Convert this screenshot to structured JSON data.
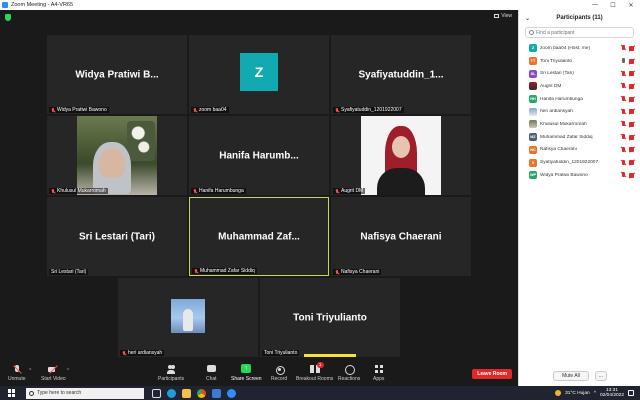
{
  "window": {
    "title": "Zoom Meeting - A4-VR65",
    "minimize": "—",
    "maximize": "☐",
    "close": "✕"
  },
  "meeting": {
    "view_label": "View",
    "tiles": [
      {
        "big": "Widya Pratiwi B...",
        "label": "Widya Pratiwi Bawono"
      },
      {
        "big": "",
        "avatar": "Z",
        "label": "zoom baa04"
      },
      {
        "big": "Syafiyatuddin_1...",
        "label": "Syafiyatuddin_1201922007"
      },
      {
        "big": "",
        "label": "Khulusul Mukarromah"
      },
      {
        "big": "Hanifa  Harumb...",
        "label": "Hanifa Harumbunga"
      },
      {
        "big": "",
        "label": "Augrit DM"
      },
      {
        "big": "Sri Lestari (Tari)",
        "label": "Sri Lestari (Tari)"
      },
      {
        "big": "Muhammad  Zaf...",
        "label": "Muhammad Zafar Siddiq"
      },
      {
        "big": "Nafisya Chaerani",
        "label": "Nafisya Chaerani"
      },
      {
        "big": "",
        "label": "heri ardiansyah"
      },
      {
        "big": "Toni Triyulianto",
        "label": "Toni Triyulianto"
      }
    ]
  },
  "toolbar": {
    "unmute": "Unmute",
    "start_video": "Start Video",
    "participants": "Participants",
    "participants_count": "11",
    "chat": "Chat",
    "share_screen": "Share Screen",
    "record": "Record",
    "breakout_rooms": "Breakout Rooms",
    "breakout_badge": "1",
    "reactions": "Reactions",
    "apps": "Apps",
    "leave": "Leave Room"
  },
  "panel": {
    "title": "Participants (11)",
    "search_placeholder": "Find a participant",
    "participants": [
      {
        "initials": "Z",
        "color": "#10aab0",
        "name": "zoom baa04 (Host, me)",
        "mic_on": false,
        "video_on": false
      },
      {
        "initials": "TT",
        "color": "#e8742a",
        "name": "Toni Triyulianto",
        "mic_on": true,
        "video_on": false
      },
      {
        "initials": "SL",
        "color": "#8a4fc7",
        "name": "Sri Lestari (Tari)",
        "mic_on": false,
        "video_on": false
      },
      {
        "initials": "",
        "photo": "photo-av",
        "name": "Augrit DM",
        "mic_on": false,
        "video_on": false
      },
      {
        "initials": "HH",
        "color": "#2ba66b",
        "name": "Hanifa Harumbunga",
        "mic_on": false,
        "video_on": false
      },
      {
        "initials": "",
        "photo": "photo-av2",
        "name": "heri ardiansyah",
        "mic_on": false,
        "video_on": false
      },
      {
        "initials": "",
        "photo": "photo-av3",
        "name": "Khulusul Mukarromah",
        "mic_on": false,
        "video_on": false
      },
      {
        "initials": "MZ",
        "color": "#4a6472",
        "name": "Muhammad Zafar Siddiq",
        "mic_on": false,
        "video_on": false
      },
      {
        "initials": "NC",
        "color": "#e8742a",
        "name": "Nafisya Chaerani",
        "mic_on": false,
        "video_on": false
      },
      {
        "initials": "S",
        "color": "#e8742a",
        "name": "Syafiyatuddin_1201922007",
        "mic_on": false,
        "video_on": false
      },
      {
        "initials": "WP",
        "color": "#2ba66b",
        "name": "Widya Pratiwi Bawono",
        "mic_on": false,
        "video_on": false
      }
    ],
    "mute_all": "Mute All",
    "more": "..."
  },
  "taskbar": {
    "search_placeholder": "Type here to search",
    "weather": "31°C  Hujan",
    "time": "13:31",
    "date": "02/04/2022"
  }
}
